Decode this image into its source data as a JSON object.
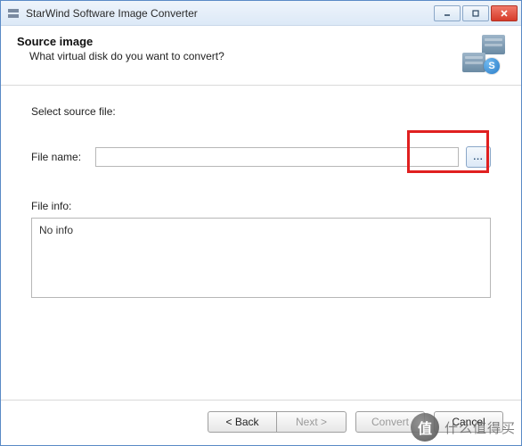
{
  "window": {
    "title": "StarWind Software Image Converter"
  },
  "header": {
    "title": "Source image",
    "subtitle": "What virtual disk do you want to convert?",
    "badge_letter": "S"
  },
  "content": {
    "select_label": "Select source file:",
    "filename_label": "File name:",
    "filename_value": "",
    "browse_label": "...",
    "fileinfo_label": "File info:",
    "fileinfo_value": "No info"
  },
  "footer": {
    "back": "< Back",
    "next": "Next >",
    "convert": "Convert",
    "cancel": "Cancel"
  },
  "watermark": {
    "symbol": "值",
    "text": "什么值得买"
  }
}
